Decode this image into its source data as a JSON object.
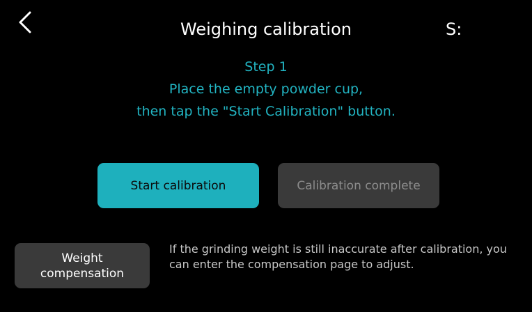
{
  "header": {
    "back_icon": "chevron-left-icon",
    "title": "Weighing calibration",
    "status_label": "S:"
  },
  "instructions": {
    "step": "Step 1",
    "line1": "Place the empty powder cup,",
    "line2": "then tap the \"Start Calibration\" button."
  },
  "actions": {
    "start_label": "Start calibration",
    "complete_label": "Calibration complete"
  },
  "compensation": {
    "button_line1": "Weight",
    "button_line2": "compensation",
    "note": "If the grinding weight is still inaccurate after calibration, you can enter the compensation page to adjust."
  },
  "colors": {
    "background": "#000000",
    "accent": "#1eb0bd",
    "instruction_text": "#22b4c2",
    "disabled_button": "#3a3a3a",
    "disabled_text": "#8c8c8c"
  }
}
